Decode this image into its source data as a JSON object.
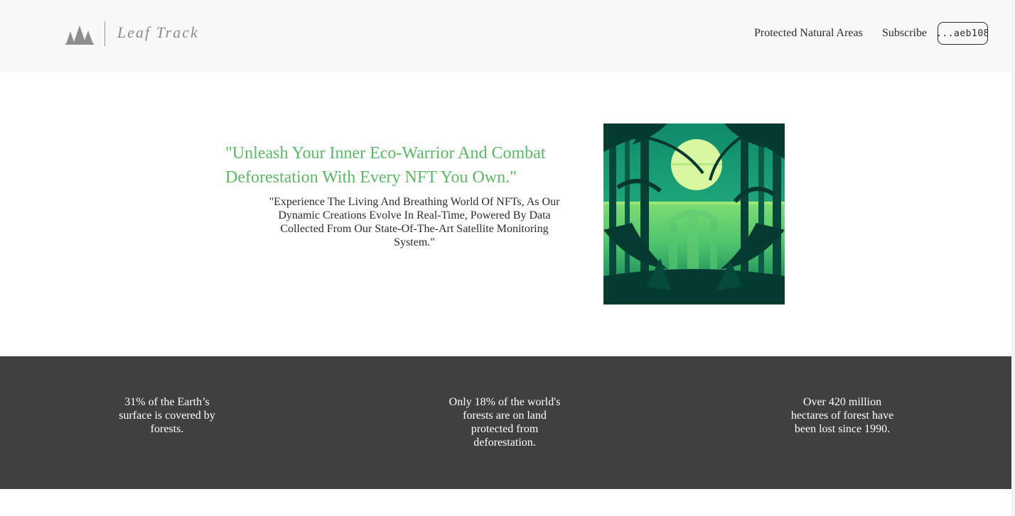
{
  "header": {
    "logo_icon": "trees-icon",
    "brand_name": "Leaf Track",
    "nav": {
      "protected_areas": "Protected Natural Areas",
      "subscribe": "Subscribe"
    },
    "wallet_label": "...aeb108"
  },
  "hero": {
    "heading": "\"Unleash Your Inner Eco-Warrior And Combat Deforestation With Every NFT You Own.\"",
    "subheading": "\"Experience The Living And Breathing World Of NFTs, As Our Dynamic Creations Evolve In Real-Time, Powered By Data Collected From Our State-Of-The-Art Satellite Monitoring System.\"",
    "image_icon": "forest-moon-illustration"
  },
  "stats": [
    {
      "text": "31% of the Earth’s surface is covered by forests."
    },
    {
      "text": "Only 18% of the world's forests are on land protected from deforestation."
    },
    {
      "text": "Over 420 million hectares of forest have been lost since 1990."
    }
  ],
  "colors": {
    "accent_green": "#5cb866",
    "header_bg": "#f9f8f6",
    "stats_bg": "#404040"
  }
}
